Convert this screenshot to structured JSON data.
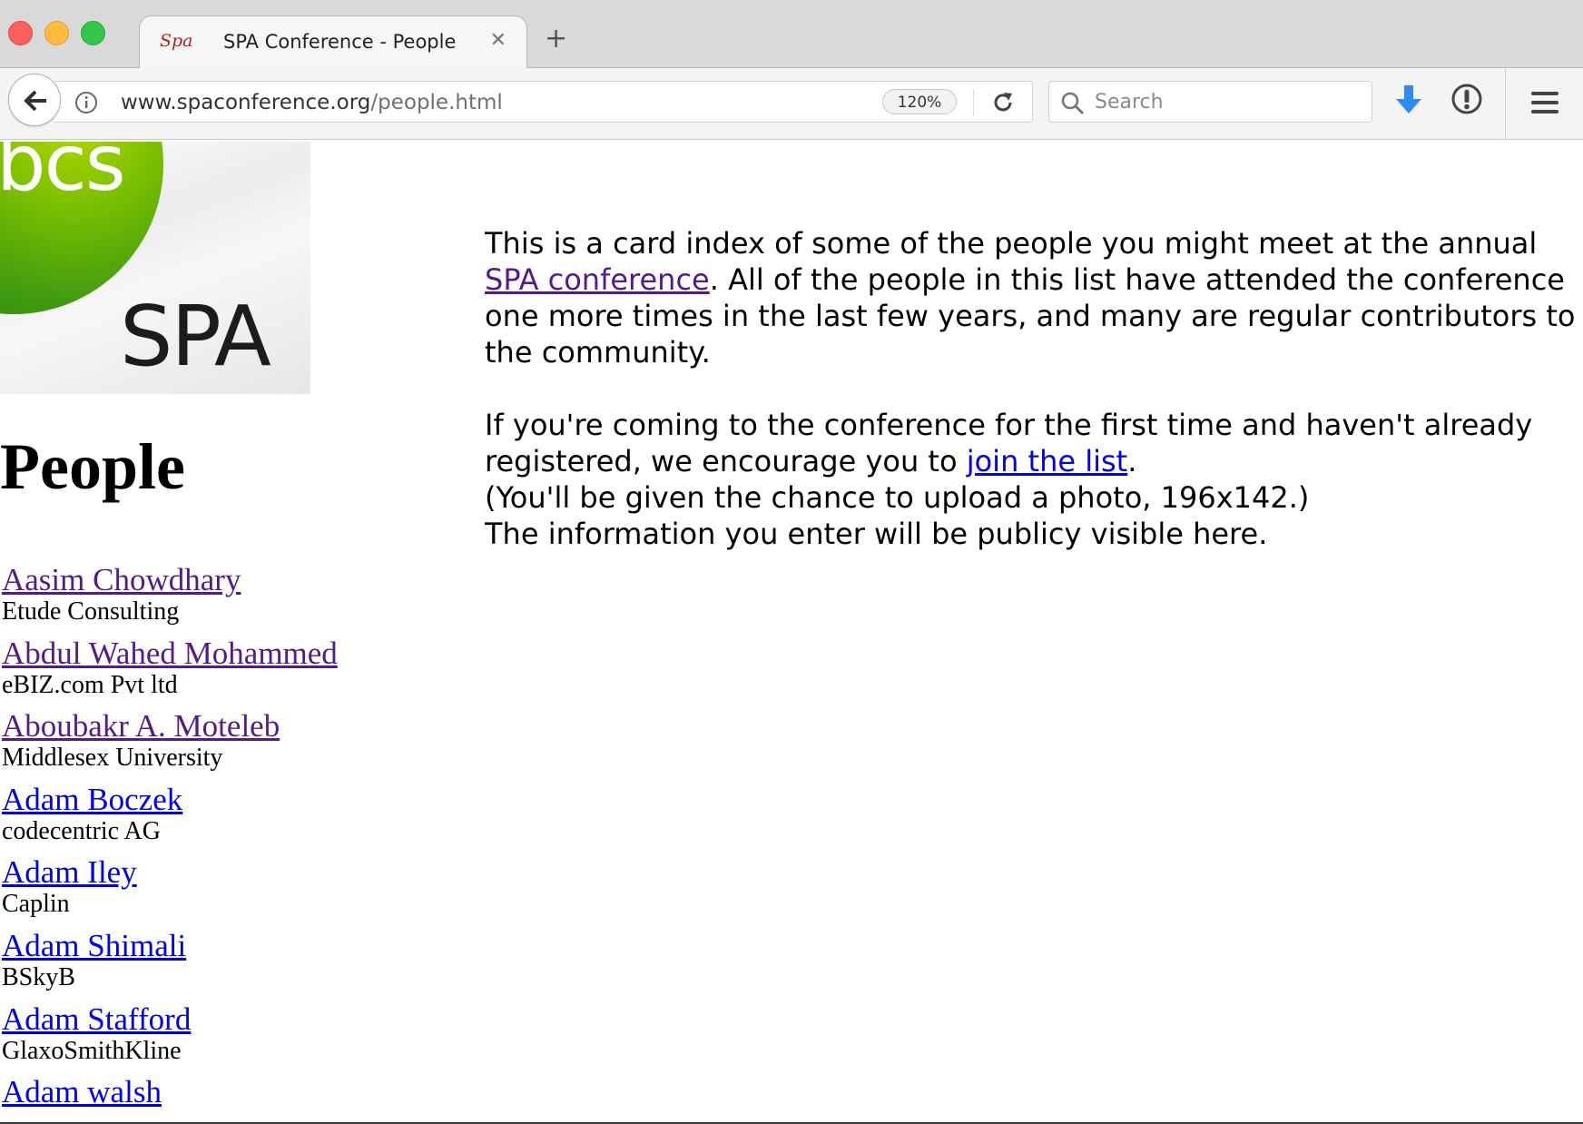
{
  "browser": {
    "tab": {
      "favicon_text": "Spa",
      "title": "SPA Conference - People",
      "close_glyph": "✕"
    },
    "new_tab_glyph": "+",
    "url": {
      "host": "www.spaconference.org",
      "path": "/people.html"
    },
    "zoom": "120%",
    "search_placeholder": "Search"
  },
  "logo": {
    "top_text": "bcs",
    "bottom_text": "SPA"
  },
  "page": {
    "heading": "People",
    "intro": {
      "p1_before": "This is a card index of some of the people you might meet at the annual ",
      "p1_link": "SPA conference",
      "p1_after": ". All of the people in this list have attended the conference one more times in the last few years, and many are regular contributors to the community.",
      "p2_before": "If you're coming to the conference for the first time and haven't already registered, we encourage you to ",
      "p2_link": "join the list",
      "p2_after": ".",
      "p2_line2": "(You'll be given the chance to upload a photo, 196x142.)",
      "p2_line3": "The information you enter will be publicy visible here."
    },
    "people": [
      {
        "name": "Aasim Chowdhary",
        "org": "Etude Consulting",
        "visited": true
      },
      {
        "name": "Abdul Wahed Mohammed",
        "org": "eBIZ.com Pvt ltd",
        "visited": true
      },
      {
        "name": "Aboubakr A. Moteleb",
        "org": "Middlesex University",
        "visited": true
      },
      {
        "name": "Adam Boczek",
        "org": "codecentric AG",
        "visited": false
      },
      {
        "name": "Adam Iley",
        "org": "Caplin",
        "visited": false
      },
      {
        "name": "Adam Shimali",
        "org": "BSkyB",
        "visited": false
      },
      {
        "name": "Adam Stafford",
        "org": "GlaxoSmithKline",
        "visited": false
      },
      {
        "name": "Adam walsh",
        "org": "",
        "visited": false
      }
    ]
  },
  "colors": {
    "link": "#0000ee",
    "visited_link": "#551a8b",
    "download_arrow": "#2d8cf0"
  }
}
